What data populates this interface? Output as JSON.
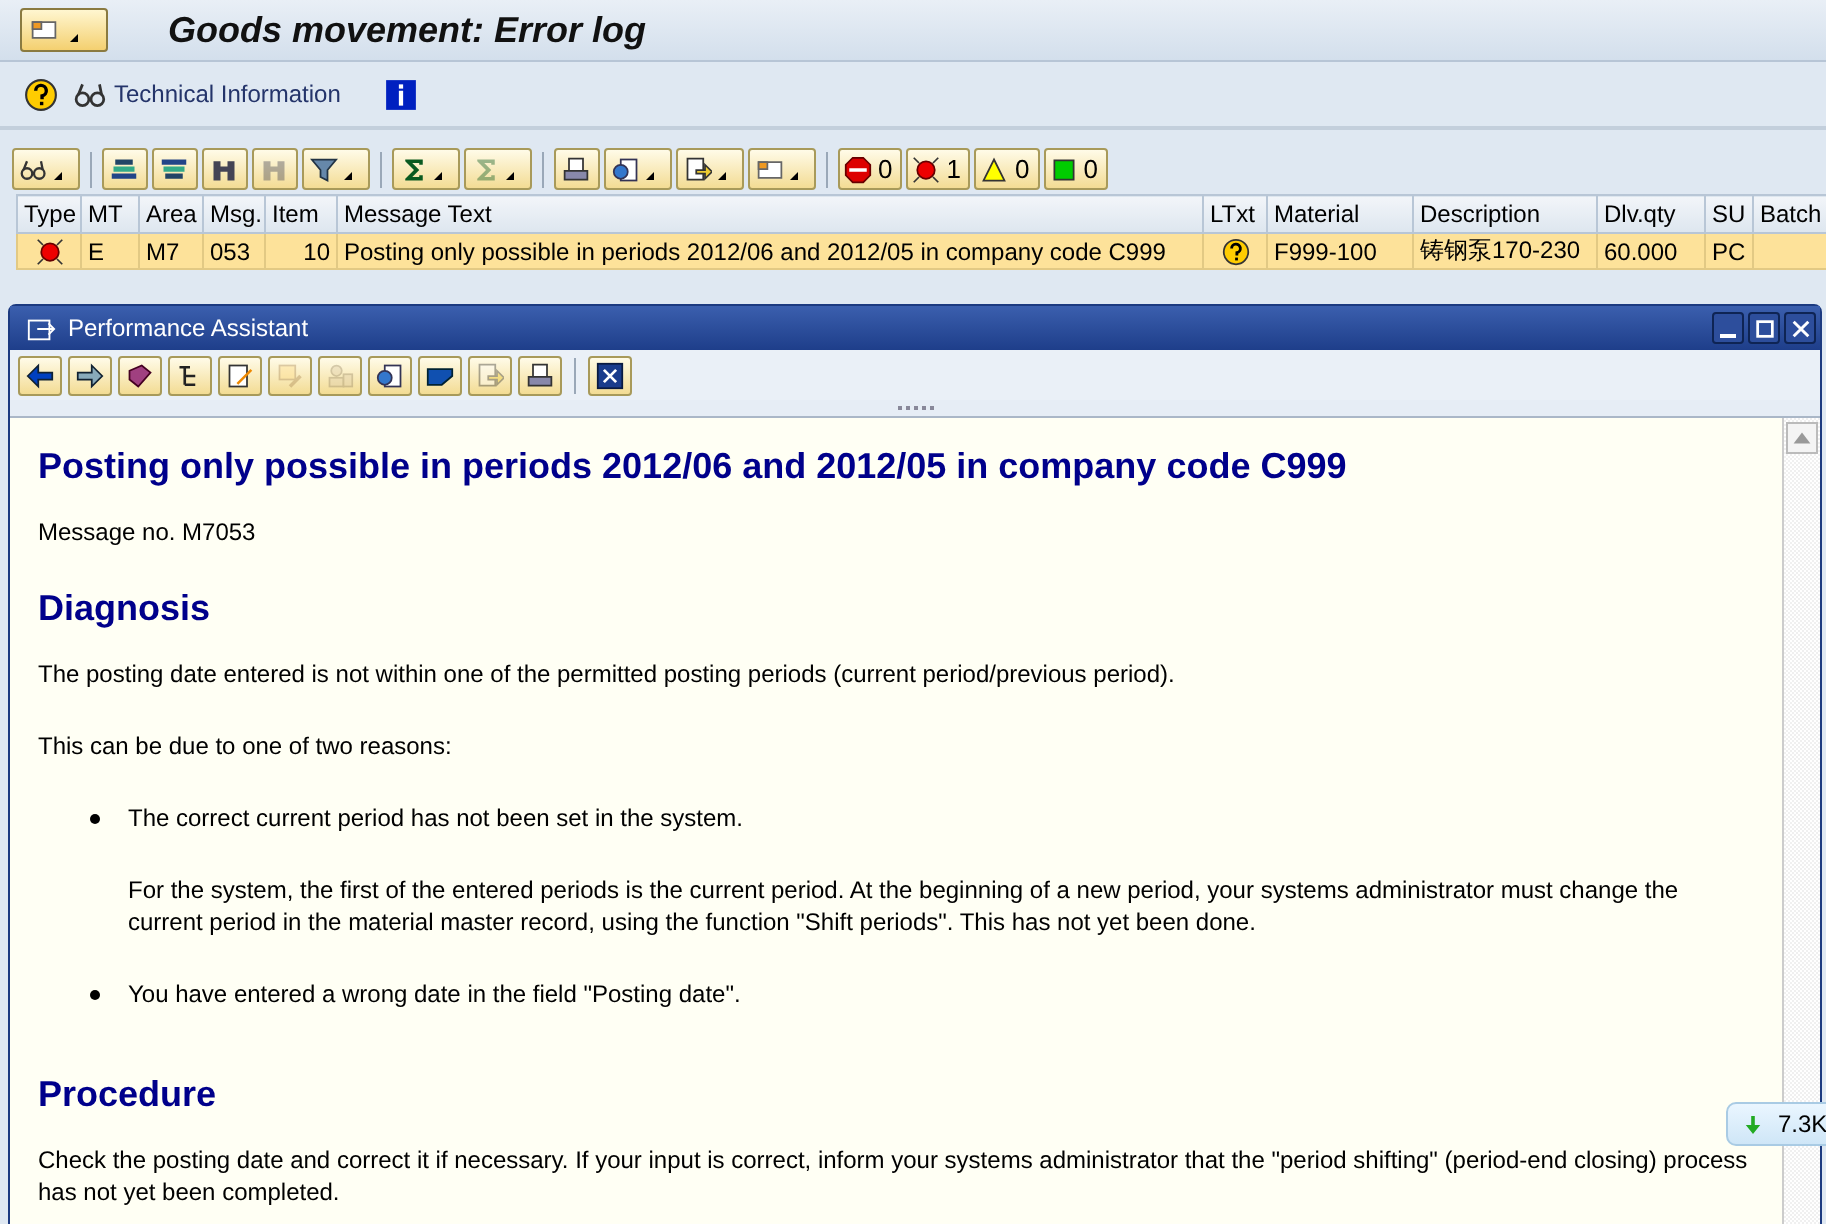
{
  "title_bar": {
    "title": "Goods movement: Error log"
  },
  "app_toolbar": {
    "technical_information": "Technical Information"
  },
  "alv_toolbar": {
    "buttons": [
      {
        "dropdown": true,
        "disabled": false
      },
      {
        "dropdown": false,
        "disabled": false
      },
      {
        "dropdown": false,
        "disabled": false
      },
      {
        "dropdown": false,
        "disabled": false
      },
      {
        "dropdown": false,
        "disabled": true
      },
      {
        "dropdown": true,
        "disabled": false
      },
      {
        "dropdown": true,
        "disabled": false
      },
      {
        "dropdown": true,
        "disabled": true
      },
      {
        "dropdown": false,
        "disabled": false
      },
      {
        "dropdown": true,
        "disabled": false
      },
      {
        "dropdown": true,
        "disabled": false
      },
      {
        "dropdown": true,
        "disabled": false
      }
    ],
    "counters": [
      {
        "kind": "stop",
        "count": "0"
      },
      {
        "kind": "error",
        "count": "1"
      },
      {
        "kind": "warning",
        "count": "0"
      },
      {
        "kind": "success",
        "count": "0"
      }
    ]
  },
  "table": {
    "columns": [
      "Type",
      "MT",
      "Area",
      "Msg.",
      "Item",
      "Message Text",
      "LTxt",
      "Material",
      "Description",
      "Dlv.qty",
      "SU",
      "Batch"
    ],
    "rows": [
      {
        "kind": "error",
        "selected": true,
        "cells": [
          "",
          "E",
          "M7",
          "053",
          "10",
          "Posting only possible in periods 2012/06 and 2012/05 in company code C999",
          "",
          "F999-100",
          "铸钢泵170-230",
          "60.000",
          "PC",
          ""
        ]
      }
    ]
  },
  "popup": {
    "title": "Performance Assistant",
    "buttons": [
      {
        "disabled": false
      },
      {
        "disabled": false
      },
      {
        "disabled": false
      },
      {
        "disabled": false
      },
      {
        "disabled": false
      },
      {
        "disabled": true
      },
      {
        "disabled": true
      },
      {
        "disabled": false
      },
      {
        "disabled": false
      },
      {
        "disabled": true
      },
      {
        "disabled": false
      },
      {
        "disabled": false
      }
    ],
    "content": [
      {
        "kind": "h1",
        "text": "Posting only possible in periods 2012/06 and 2012/05 in company code C999"
      },
      {
        "kind": "p",
        "text": "Message no. M7053"
      },
      {
        "kind": "h2",
        "text": "Diagnosis"
      },
      {
        "kind": "p",
        "text": "The posting date entered is not within one of the permitted posting periods (current period/previous period)."
      },
      {
        "kind": "p",
        "text": "This can be due to one of two reasons:"
      },
      {
        "kind": "bullet",
        "text": "The correct current period has not been set in the system."
      },
      {
        "kind": "indent",
        "text": "For the system, the first of the entered periods is the current period. At the beginning of a new period, your systems administrator must change the current period in the material master record, using the function \"Shift periods\". This has not yet been done."
      },
      {
        "kind": "bullet",
        "text": "You have entered a wrong date in the field \"Posting date\"."
      },
      {
        "kind": "h2",
        "text": "Procedure"
      },
      {
        "kind": "p",
        "text": "Check the posting date and correct it if necessary. If your input is correct, inform your systems administrator that the \"period shifting\" (period-end closing) process has not yet been completed."
      }
    ]
  },
  "download_badge": {
    "text": "7.3K"
  }
}
